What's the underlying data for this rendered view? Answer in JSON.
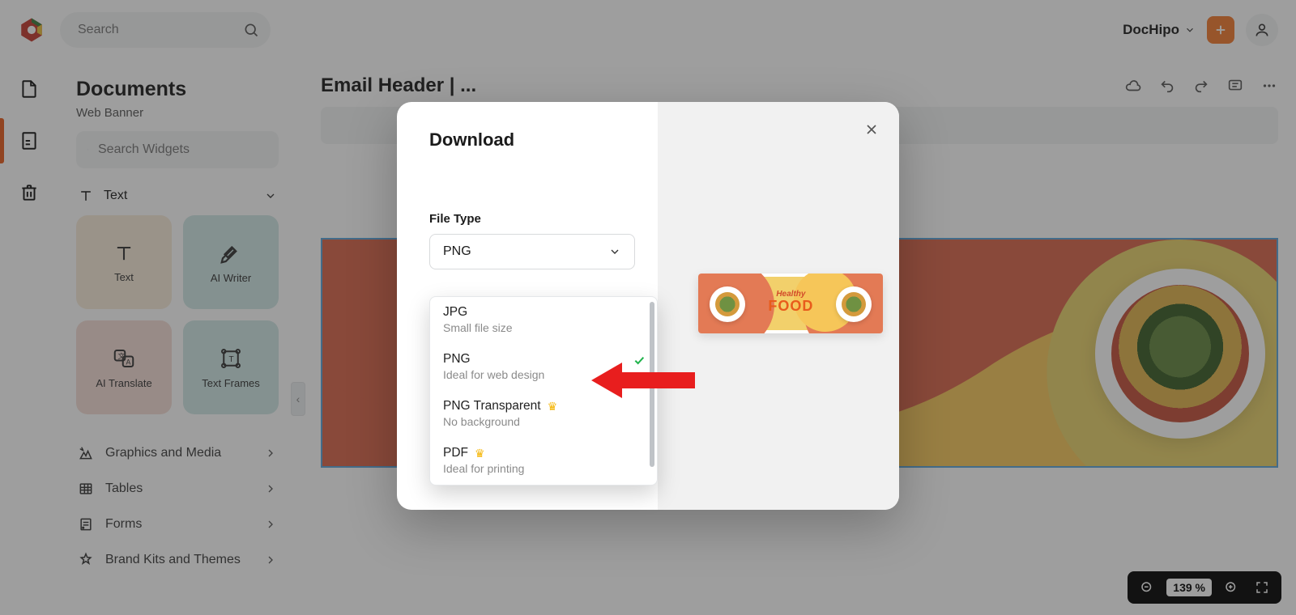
{
  "top": {
    "search_placeholder": "Search",
    "brand": "DocHipo"
  },
  "side": {
    "title": "Documents",
    "subtitle": "Web Banner",
    "widget_search_placeholder": "Search Widgets",
    "section_text": "Text",
    "cards": {
      "text": "Text",
      "ai_writer": "AI Writer",
      "ai_translate": "AI Translate",
      "text_frames": "Text Frames"
    },
    "rows": {
      "graphics": "Graphics and Media",
      "tables": "Tables",
      "forms": "Forms",
      "brandkits": "Brand Kits and Themes"
    }
  },
  "doc": {
    "title": "Email Header | ..."
  },
  "modal": {
    "title": "Download",
    "filetype_label": "File Type",
    "selected": "PNG",
    "options": [
      {
        "title": "JPG",
        "desc": "Small file size",
        "premium": false,
        "selected": false
      },
      {
        "title": "PNG",
        "desc": "Ideal for web design",
        "premium": false,
        "selected": true
      },
      {
        "title": "PNG Transparent",
        "desc": "No background",
        "premium": true,
        "selected": false
      },
      {
        "title": "PDF",
        "desc": "Ideal for printing",
        "premium": true,
        "selected": false
      }
    ],
    "preview": {
      "line1": "Healthy",
      "line2": "FOOD"
    }
  },
  "zoom": {
    "value": "139 %"
  }
}
